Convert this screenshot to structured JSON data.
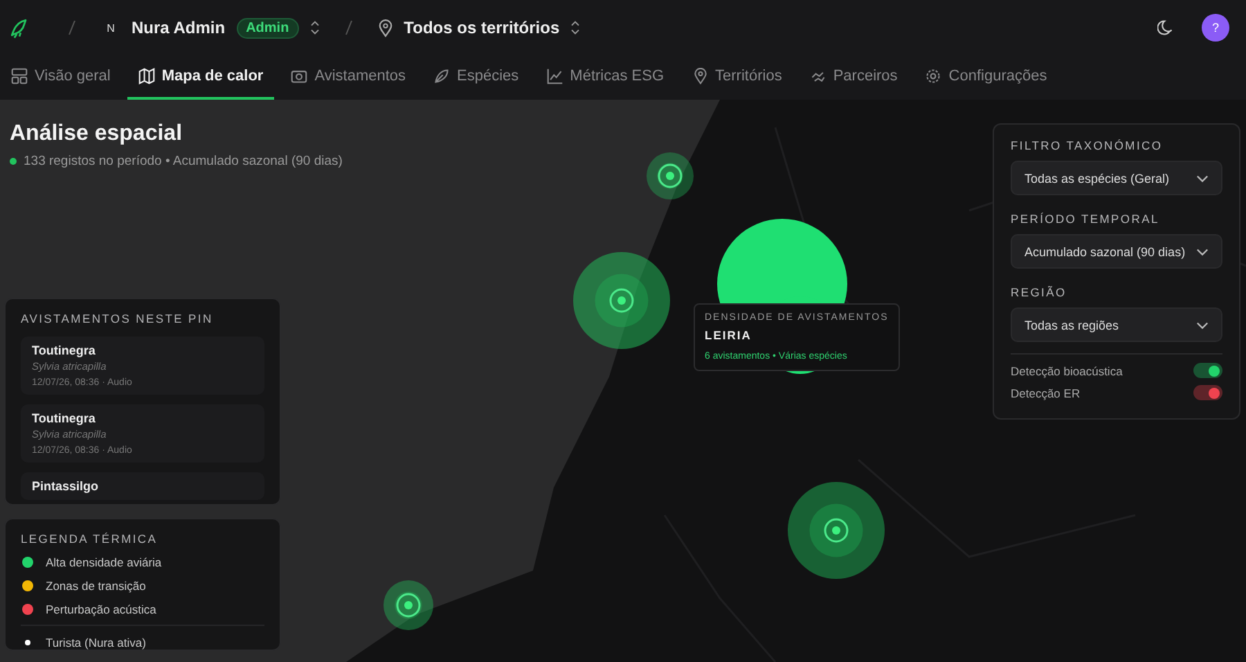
{
  "header": {
    "user_initial": "N",
    "user_name": "Nura Admin",
    "role_badge": "Admin",
    "territory": "Todos os territórios",
    "avatar": "?"
  },
  "tabs": [
    {
      "label": "Visão geral",
      "selected": false
    },
    {
      "label": "Mapa de calor",
      "selected": true
    },
    {
      "label": "Avistamentos",
      "selected": false
    },
    {
      "label": "Espécies",
      "selected": false
    },
    {
      "label": "Métricas ESG",
      "selected": false
    },
    {
      "label": "Territórios",
      "selected": false
    },
    {
      "label": "Parceiros",
      "selected": false
    },
    {
      "label": "Configurações",
      "selected": false
    }
  ],
  "page": {
    "title": "Análise espacial",
    "subtitle": "133 registos no período • Acumulado sazonal (90 dias)"
  },
  "pin_panel": {
    "title": "AVISTAMENTOS NESTE PIN",
    "items": [
      {
        "name": "Toutinegra",
        "scientific": "Sylvia atricapilla",
        "meta": "12/07/26, 08:36 · Audio"
      },
      {
        "name": "Toutinegra",
        "scientific": "Sylvia atricapilla",
        "meta": "12/07/26, 08:36 · Audio"
      },
      {
        "name": "Pintassilgo"
      }
    ]
  },
  "legend": {
    "title": "LEGENDA TÉRMICA",
    "items": [
      {
        "label": "Alta densidade aviária",
        "color": "#22d36b",
        "kind": "zone"
      },
      {
        "label": "Zonas de transição",
        "color": "#f2b705",
        "kind": "zone"
      },
      {
        "label": "Perturbação acústica",
        "color": "#f0434f",
        "kind": "zone"
      },
      {
        "label": "Turista (Nura ativa)",
        "color": "#ffffff",
        "kind": "user"
      }
    ]
  },
  "tooltip": {
    "title": "DENSIDADE DE AVISTAMENTOS",
    "place": "LEIRIA",
    "detail": "6 avistamentos • Várias espécies"
  },
  "filters": [
    {
      "label": "FILTRO TAXONÓMICO",
      "value": "Todas as espécies (Geral)"
    },
    {
      "label": "PERÍODO TEMPORAL",
      "value": "Acumulado sazonal (90 dias)"
    },
    {
      "label": "REGIÃO",
      "value": "Todas as regiões"
    }
  ],
  "toggles": [
    {
      "label": "Detecção bioacústica",
      "on": true,
      "color": "#22d36b"
    },
    {
      "label": "Detecção ER",
      "on": true,
      "color": "#f0434f"
    }
  ]
}
